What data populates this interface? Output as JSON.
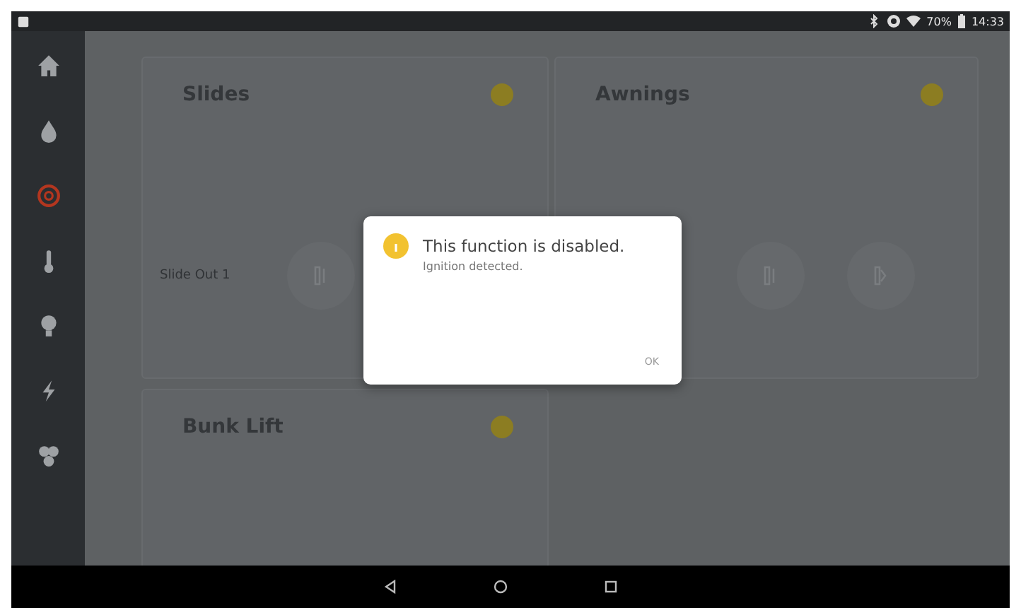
{
  "status_bar": {
    "battery": "70%",
    "time": "14:33"
  },
  "sidebar": {
    "items": [
      {
        "kind": "home",
        "selected": false
      },
      {
        "kind": "water",
        "selected": false
      },
      {
        "kind": "slides",
        "selected": true
      },
      {
        "kind": "temperature",
        "selected": false
      },
      {
        "kind": "light",
        "selected": false
      },
      {
        "kind": "power",
        "selected": false
      },
      {
        "kind": "fan",
        "selected": false
      }
    ]
  },
  "cards": [
    {
      "title": "Slides",
      "label": "Slide Out 1",
      "buttons": [
        {
          "kind": "retract"
        }
      ]
    },
    {
      "title": "Awnings",
      "buttons": [
        {
          "kind": "retract"
        },
        {
          "kind": "extend"
        }
      ]
    },
    {
      "title": "Bunk Lift"
    }
  ],
  "dialog": {
    "title": "This function is disabled.",
    "message": "Ignition detected.",
    "button": "OK"
  }
}
